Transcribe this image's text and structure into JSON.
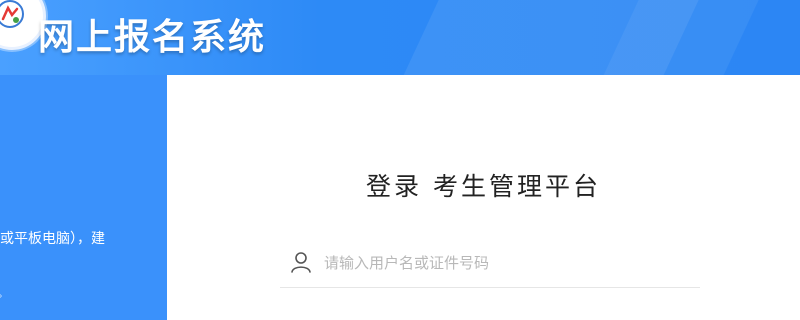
{
  "header": {
    "site_title": "网上报名系统",
    "logo_icon": "org-logo-icon"
  },
  "left_panel": {
    "notice_fragment": "或平板电脑），建",
    "notice_tail": "。"
  },
  "login": {
    "title": "登录 考生管理平台",
    "username_icon": "user-icon",
    "username_placeholder": "请输入用户名或证件号码",
    "username_value": ""
  },
  "colors": {
    "header_blue": "#2d8af6",
    "panel_blue": "#3a91fb",
    "card_bg": "#ffffff"
  }
}
